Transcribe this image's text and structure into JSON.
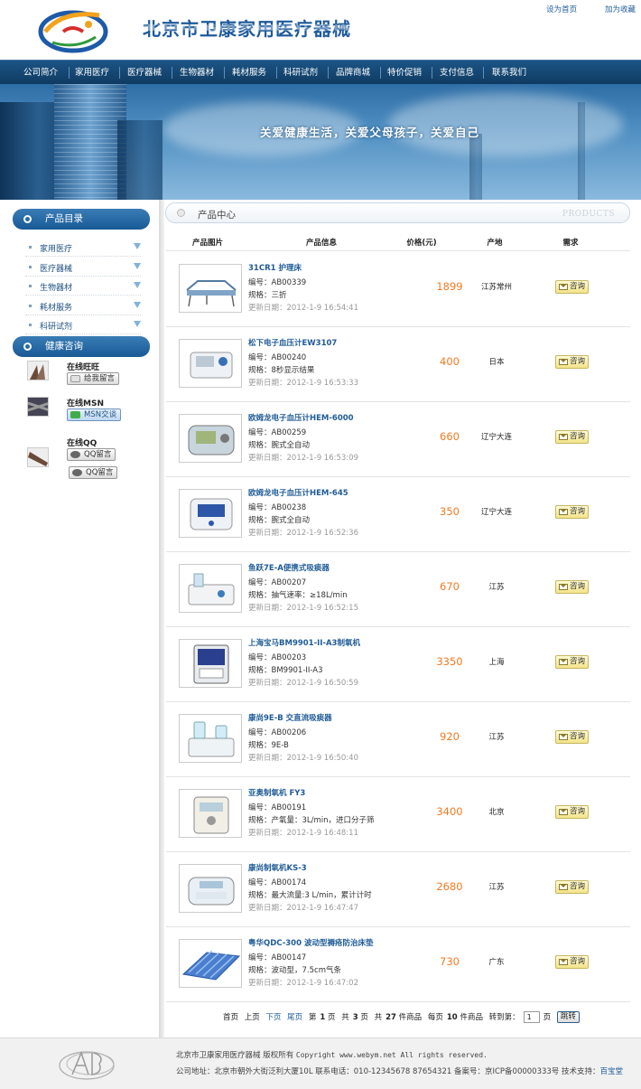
{
  "header": {
    "site_title": "北京市卫康家用医疗器械",
    "set_home": "设为首页",
    "add_favorite": "加为收藏"
  },
  "nav": [
    "公司简介",
    "家用医疗",
    "医疗器械",
    "生物器材",
    "耗材服务",
    "科研试剂",
    "品牌商城",
    "特价促销",
    "支付信息",
    "联系我们"
  ],
  "banner": {
    "slogan": "关爱健康生活，关爱父母孩子，关爱自己"
  },
  "sidebar": {
    "catalog_title": "产品目录",
    "categories": [
      "家用医疗",
      "医疗器械",
      "生物器材",
      "耗材服务",
      "科研试剂"
    ],
    "consult_title": "健康咨询",
    "contacts": [
      {
        "title": "在线旺旺",
        "buttons": [
          "给我留言"
        ]
      },
      {
        "title": "在线MSN",
        "buttons": [
          "MSN交谈"
        ]
      },
      {
        "title": "在线QQ",
        "buttons": [
          "QQ留言",
          "QQ留言"
        ]
      }
    ]
  },
  "main": {
    "section_title": "产品中心",
    "section_en": "PRODUCTS",
    "columns": [
      "产品图片",
      "产品信息",
      "价格(元)",
      "产地",
      "需求"
    ],
    "code_label": "编号：",
    "spec_label": "规格：",
    "date_label": "更新日期：",
    "ask_label": "咨询",
    "products": [
      {
        "name": "31CR1 护理床",
        "code": "AB00339",
        "spec": "三折",
        "date": "2012-1-9 16:54:41",
        "price": "1899",
        "origin": "江苏常州"
      },
      {
        "name": "松下电子血压计EW3107",
        "code": "AB00240",
        "spec": "8秒显示结果",
        "date": "2012-1-9 16:53:33",
        "price": "400",
        "origin": "日本"
      },
      {
        "name": "欧姆龙电子血压计HEM-6000",
        "code": "AB00259",
        "spec": "腕式全自动",
        "date": "2012-1-9 16:53:09",
        "price": "660",
        "origin": "辽宁大连"
      },
      {
        "name": "欧姆龙电子血压计HEM-645",
        "code": "AB00238",
        "spec": "腕式全自动",
        "date": "2012-1-9 16:52:36",
        "price": "350",
        "origin": "辽宁大连"
      },
      {
        "name": "鱼跃7E-A便携式吸痰器",
        "code": "AB00207",
        "spec": "抽气速率：≥18L/min",
        "date": "2012-1-9 16:52:15",
        "price": "670",
        "origin": "江苏"
      },
      {
        "name": "上海宝马BM9901-II-A3制氧机",
        "code": "AB00203",
        "spec": "BM9901-II-A3",
        "date": "2012-1-9 16:50:59",
        "price": "3350",
        "origin": "上海"
      },
      {
        "name": "康尚9E-B 交直流吸痰器",
        "code": "AB00206",
        "spec": "9E-B",
        "date": "2012-1-9 16:50:40",
        "price": "920",
        "origin": "江苏"
      },
      {
        "name": "亚奥制氧机 FY3",
        "code": "AB00191",
        "spec": "产氧量：3L/min，进口分子筛",
        "date": "2012-1-9 16:48:11",
        "price": "3400",
        "origin": "北京"
      },
      {
        "name": "康尚制氧机KS-3",
        "code": "AB00174",
        "spec": "最大流量:3 L/min，累计计时",
        "date": "2012-1-9 16:47:47",
        "price": "2680",
        "origin": "江苏"
      },
      {
        "name": "粤华QDC-300 波动型褥疮防治床垫",
        "code": "AB00147",
        "spec": "波动型，7.5cm气条",
        "date": "2012-1-9 16:47:02",
        "price": "730",
        "origin": "广东"
      }
    ]
  },
  "pager": {
    "first": "首页",
    "prev": "上页",
    "next": "下页",
    "last": "尾页",
    "page_prefix": "第",
    "current_page": "1",
    "page_unit": "页",
    "total_prefix": "共",
    "total_pages": "3",
    "total_items": "27",
    "items_unit": "件商品",
    "per_page_prefix": "每页",
    "per_page": "10",
    "goto_label": "转到第：",
    "input_value": "1",
    "go_label": "跳转"
  },
  "footer": {
    "line1_name": "北京市卫康家用医疗器械 版权所有",
    "line1_copy": "Copyright www.webym.net All rights reserved.",
    "line2_text": "公司地址：北京市朝外大街泛利大厦10L 联系电话：010-12345678 87654321 备案号：京ICP备00000333号 技术支持：",
    "support": "百宝堂"
  },
  "colors": {
    "nav_bg": "#0f3a62",
    "accent_blue": "#1f5b96",
    "price_orange": "#f37a21"
  }
}
